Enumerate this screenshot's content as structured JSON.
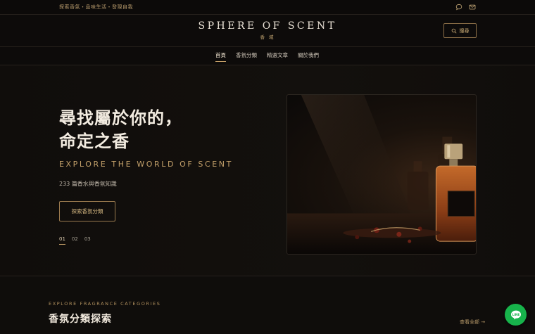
{
  "topbar": {
    "tagline": "探索香氣・品味生活・發現自我",
    "icons": [
      "chat-bubble-icon",
      "mail-icon"
    ]
  },
  "header": {
    "logo": "SPHERE OF SCENT",
    "logo_sub": "香 域",
    "search_label": "搜尋"
  },
  "nav": {
    "items": [
      {
        "label": "首頁",
        "active": true
      },
      {
        "label": "香氛分類",
        "active": false
      },
      {
        "label": "精選文章",
        "active": false
      },
      {
        "label": "關於我們",
        "active": false
      }
    ]
  },
  "hero": {
    "title_line1": "尋找屬於你的，",
    "title_line2": "命定之香",
    "subtitle": "EXPLORE THE WORLD OF SCENT",
    "count": "233 篇香水與香氛知識",
    "cta": "探索香氛分類",
    "pages": [
      {
        "label": "01",
        "active": true
      },
      {
        "label": "02",
        "active": false
      },
      {
        "label": "03",
        "active": false
      }
    ]
  },
  "section": {
    "eyebrow": "EXPLORE FRAGRANCE CATEGORIES",
    "title": "香氛分類探索",
    "view_all": "查看全部 →"
  },
  "chat_widget": {
    "label": "LINE",
    "color": "#17b34b"
  },
  "colors": {
    "background": "#0f0d0b",
    "accent_gold": "#c9a36a"
  }
}
